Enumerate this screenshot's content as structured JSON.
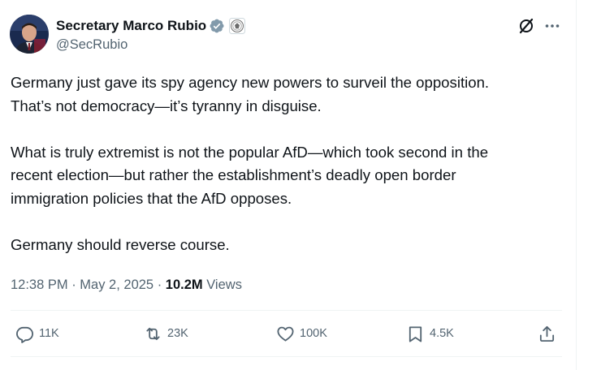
{
  "author": {
    "display_name": "Secretary Marco Rubio",
    "handle": "@SecRubio",
    "verified_icon": "verified-badge-icon",
    "affiliation_icon": "government-seal-icon"
  },
  "header_actions": {
    "grok_icon": "grok-icon",
    "more_icon": "more-options-icon"
  },
  "body": {
    "line1": "Germany just gave its spy agency new powers to surveil the opposition.",
    "line2": "That’s not democracy—it’s tyranny in disguise.",
    "line3": "What is truly extremist is not the popular AfD—which took second in the",
    "line4": "recent election—but rather the establishment’s deadly open border",
    "line5": "immigration policies that the AfD opposes.",
    "line6": "Germany should reverse course."
  },
  "meta": {
    "time": "12:38 PM",
    "sep1": " · ",
    "date": "May 2, 2025",
    "sep2": " · ",
    "views_count": "10.2M",
    "views_label": " Views"
  },
  "actions": {
    "replies": "11K",
    "reposts": "23K",
    "likes": "100K",
    "bookmarks": "4.5K"
  },
  "colors": {
    "text_primary": "#0f1419",
    "text_secondary": "#536471",
    "verified_badge": "#829aab",
    "divider": "#eff3f4"
  }
}
